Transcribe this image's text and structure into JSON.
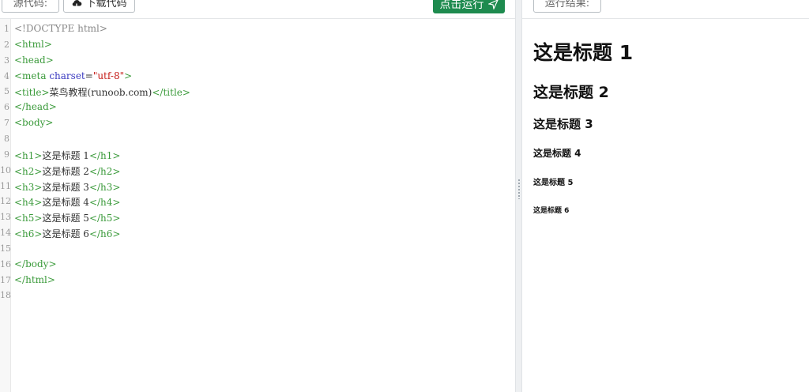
{
  "toolbar": {
    "source_label": "源代码:",
    "download_label": "下载代码",
    "run_label": "点击运行",
    "result_label": "运行结果:"
  },
  "editor": {
    "line_numbers": [
      "1",
      "2",
      "3",
      "4",
      "5",
      "6",
      "7",
      "8",
      "9",
      "10",
      "11",
      "12",
      "13",
      "14",
      "15",
      "16",
      "17",
      "18"
    ],
    "lines": [
      "<!DOCTYPE html>",
      "<html>",
      "<head>",
      "<meta charset=\"utf-8\">",
      "<title>菜鸟教程(runoob.com)</title>",
      "</head>",
      "<body>",
      "",
      "<h1>这是标题 1</h1>",
      "<h2>这是标题 2</h2>",
      "<h3>这是标题 3</h3>",
      "<h4>这是标题 4</h4>",
      "<h5>这是标题 5</h5>",
      "<h6>这是标题 6</h6>",
      "",
      "</body>",
      "</html>",
      ""
    ]
  },
  "output": {
    "h1": "这是标题 1",
    "h2": "这是标题 2",
    "h3": "这是标题 3",
    "h4": "这是标题 4",
    "h5": "这是标题 5",
    "h6": "这是标题 6"
  },
  "colors": {
    "run_button": "#1e8b4f",
    "tag": "#3a9a3a",
    "attr": "#3a3ac0",
    "string": "#c41a16"
  }
}
